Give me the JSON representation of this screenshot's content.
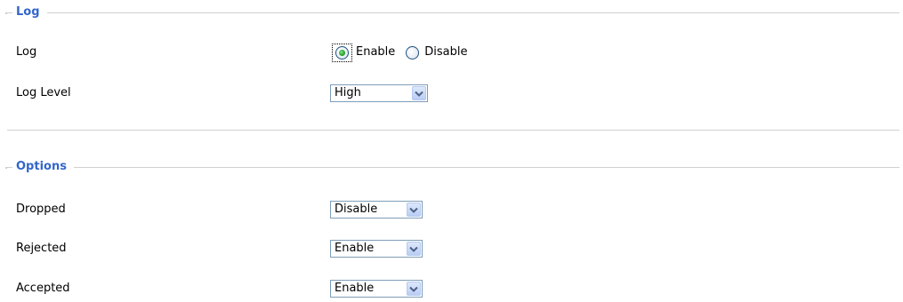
{
  "log_section": {
    "legend": "Log",
    "log_row": {
      "label": "Log",
      "enable_label": "Enable",
      "disable_label": "Disable",
      "selected": "Enable"
    },
    "level_row": {
      "label": "Log Level",
      "value": "High"
    }
  },
  "options_section": {
    "legend": "Options",
    "rows": [
      {
        "label": "Dropped",
        "value": "Disable"
      },
      {
        "label": "Rejected",
        "value": "Enable"
      },
      {
        "label": "Accepted",
        "value": "Enable"
      }
    ]
  },
  "icons": {
    "dropdown_arrow": "chevron-down-icon",
    "radio_selected": "radio-checked-icon",
    "radio_unselected": "radio-unchecked-icon"
  },
  "colors": {
    "legend": "#3366cc",
    "rule": "#cfcfcf",
    "select_border": "#7f9db9",
    "radio_dot": "#21a121"
  }
}
